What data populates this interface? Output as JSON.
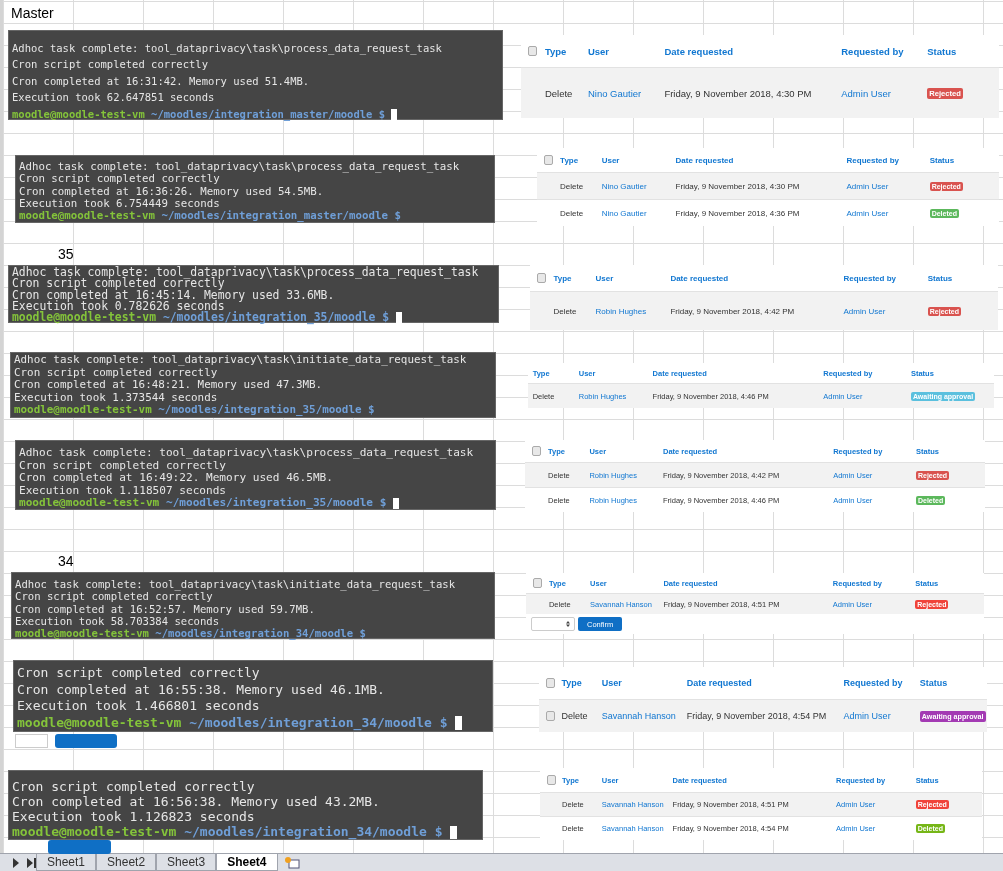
{
  "labels": [
    {
      "text": "Master"
    },
    {
      "text": "35"
    },
    {
      "text": "34"
    }
  ],
  "covered_buttons": [
    {
      "kind": "select"
    },
    {
      "kind": "button"
    },
    {
      "kind": "button"
    }
  ],
  "terminals": [
    {
      "lines": [
        "Adhoc task complete: tool_dataprivacy\\task\\process_data_request_task",
        "Cron script completed correctly",
        "Cron completed at 16:31:42. Memory used 51.4MB.",
        "Execution took 62.647851 seconds"
      ],
      "prompt_user": "moodle@moodle-test-vm",
      "prompt_path": "~/moodles/integration_master/moodle $",
      "cursor": true
    },
    {
      "lines": [
        "Adhoc task complete: tool_dataprivacy\\task\\process_data_request_task",
        "Cron script completed correctly",
        "Cron completed at 16:36:26. Memory used 54.5MB.",
        "Execution took 6.754449 seconds"
      ],
      "prompt_user": "moodle@moodle-test-vm",
      "prompt_path": "~/moodles/integration_master/moodle $",
      "cursor": false
    },
    {
      "lines": [
        "Adhoc task complete: tool_dataprivacy\\task\\process_data_request_task",
        "Cron script completed correctly",
        "Cron completed at 16:45:14. Memory used 33.6MB.",
        "Execution took 0.782626 seconds"
      ],
      "prompt_user": "moodle@moodle-test-vm",
      "prompt_path": "~/moodles/integration_35/moodle $",
      "cursor": true
    },
    {
      "lines": [
        "Adhoc task complete: tool_dataprivacy\\task\\initiate_data_request_task",
        "Cron script completed correctly",
        "Cron completed at 16:48:21. Memory used 47.3MB.",
        "Execution took 1.373544 seconds"
      ],
      "prompt_user": "moodle@moodle-test-vm",
      "prompt_path": "~/moodles/integration_35/moodle $",
      "cursor": false
    },
    {
      "lines": [
        "Adhoc task complete: tool_dataprivacy\\task\\process_data_request_task",
        "Cron script completed correctly",
        "Cron completed at 16:49:22. Memory used 46.5MB.",
        "Execution took 1.118507 seconds"
      ],
      "prompt_user": "moodle@moodle-test-vm",
      "prompt_path": "~/moodles/integration_35/moodle $",
      "cursor": true
    },
    {
      "lines": [
        "Adhoc task complete: tool_dataprivacy\\task\\initiate_data_request_task",
        "Cron script completed correctly",
        "Cron completed at 16:52:57. Memory used 59.7MB.",
        "Execution took 58.703384 seconds"
      ],
      "prompt_user": "moodle@moodle-test-vm",
      "prompt_path": "~/moodles/integration_34/moodle $",
      "cursor": false
    },
    {
      "lines": [
        "Cron script completed correctly",
        "Cron completed at 16:55:38. Memory used 46.1MB.",
        "Execution took 1.466801 seconds"
      ],
      "prompt_user": "moodle@moodle-test-vm",
      "prompt_path": "~/moodles/integration_34/moodle $",
      "cursor": true
    },
    {
      "lines": [
        "Cron script completed correctly",
        "Cron completed at 16:56:38. Memory used 43.2MB.",
        "Execution took 1.126823 seconds"
      ],
      "prompt_user": "moodle@moodle-test-vm",
      "prompt_path": "~/moodles/integration_34/moodle $",
      "cursor": true
    }
  ],
  "tables": [
    {
      "header_checkbox": {
        "checked": false
      },
      "columns": [
        "Type",
        "User",
        "Date requested",
        "Requested by",
        "Status"
      ],
      "rows": [
        {
          "shaded": true,
          "type": "Delete",
          "user": "Nino Gautier",
          "date": "Friday, 9 November 2018, 4:30 PM",
          "requested_by": "Admin User",
          "status": {
            "label": "Rejected",
            "color": "#d9534f"
          }
        }
      ]
    },
    {
      "header_checkbox": {
        "checked": false
      },
      "columns": [
        "Type",
        "User",
        "Date requested",
        "Requested by",
        "Status"
      ],
      "rows": [
        {
          "shaded": true,
          "type": "Delete",
          "user": "Nino Gautier",
          "date": "Friday, 9 November 2018, 4:30 PM",
          "requested_by": "Admin User",
          "status": {
            "label": "Rejected",
            "color": "#d9534f"
          }
        },
        {
          "shaded": false,
          "type": "Delete",
          "user": "Nino Gautier",
          "date": "Friday, 9 November 2018, 4:36 PM",
          "requested_by": "Admin User",
          "status": {
            "label": "Deleted",
            "color": "#5cb85c"
          }
        }
      ]
    },
    {
      "header_checkbox": {
        "checked": false
      },
      "columns": [
        "Type",
        "User",
        "Date requested",
        "Requested by",
        "Status"
      ],
      "rows": [
        {
          "shaded": true,
          "type": "Delete",
          "user": "Robin Hughes",
          "date": "Friday, 9 November 2018, 4:42 PM",
          "requested_by": "Admin User",
          "status": {
            "label": "Rejected",
            "color": "#d9534f"
          }
        }
      ]
    },
    {
      "columns": [
        "Type",
        "User",
        "Date requested",
        "Requested by",
        "Status"
      ],
      "rows": [
        {
          "shaded": true,
          "type": "Delete",
          "user": "Robin Hughes",
          "date": "Friday, 9 November 2018, 4:46 PM",
          "requested_by": "Admin User",
          "status": {
            "label": "Awaiting approval",
            "color": "#5bc0de"
          }
        }
      ]
    },
    {
      "header_checkbox": {
        "checked": false
      },
      "columns": [
        "Type",
        "User",
        "Date requested",
        "Requested by",
        "Status"
      ],
      "rows": [
        {
          "shaded": true,
          "type": "Delete",
          "user": "Robin Hughes",
          "date": "Friday, 9 November 2018, 4:42 PM",
          "requested_by": "Admin User",
          "status": {
            "label": "Rejected",
            "color": "#d9534f"
          }
        },
        {
          "shaded": false,
          "type": "Delete",
          "user": "Robin Hughes",
          "date": "Friday, 9 November 2018, 4:46 PM",
          "requested_by": "Admin User",
          "status": {
            "label": "Deleted",
            "color": "#5cb85c"
          }
        }
      ]
    },
    {
      "header_checkbox": {
        "checked": false
      },
      "columns": [
        "Type",
        "User",
        "Date requested",
        "Requested by",
        "Status"
      ],
      "rows": [
        {
          "shaded": true,
          "type": "Delete",
          "user": "Savannah Hanson",
          "date": "Friday, 9 November 2018, 4:51 PM",
          "requested_by": "Admin User",
          "status": {
            "label": "Rejected",
            "color": "#f0433a"
          }
        }
      ],
      "action": {
        "button": "Confirm"
      }
    },
    {
      "header_checkbox": {
        "checked": false
      },
      "columns": [
        "Type",
        "User",
        "Date requested",
        "Requested by",
        "Status"
      ],
      "rows": [
        {
          "checkbox": {
            "checked": false
          },
          "shaded": true,
          "type": "Delete",
          "user": "Savannah Hanson",
          "date": "Friday, 9 November 2018, 4:54 PM",
          "requested_by": "Admin User",
          "status": {
            "label": "Awaiting approval",
            "color": "#a33ab3"
          }
        }
      ]
    },
    {
      "header_checkbox": {
        "checked": false
      },
      "columns": [
        "Type",
        "User",
        "Date requested",
        "Requested by",
        "Status"
      ],
      "rows": [
        {
          "shaded": true,
          "type": "Delete",
          "user": "Savannah Hanson",
          "date": "Friday, 9 November 2018, 4:51 PM",
          "requested_by": "Admin User",
          "status": {
            "label": "Rejected",
            "color": "#f0433a"
          }
        },
        {
          "shaded": false,
          "type": "Delete",
          "user": "Savannah Hanson",
          "date": "Friday, 9 November 2018, 4:54 PM",
          "requested_by": "Admin User",
          "status": {
            "label": "Deleted",
            "color": "#76b617"
          }
        }
      ]
    }
  ],
  "sheet_tabs": [
    {
      "label": "Sheet1",
      "selected": false
    },
    {
      "label": "Sheet2",
      "selected": false
    },
    {
      "label": "Sheet3",
      "selected": false
    },
    {
      "label": "Sheet4",
      "selected": true
    }
  ]
}
